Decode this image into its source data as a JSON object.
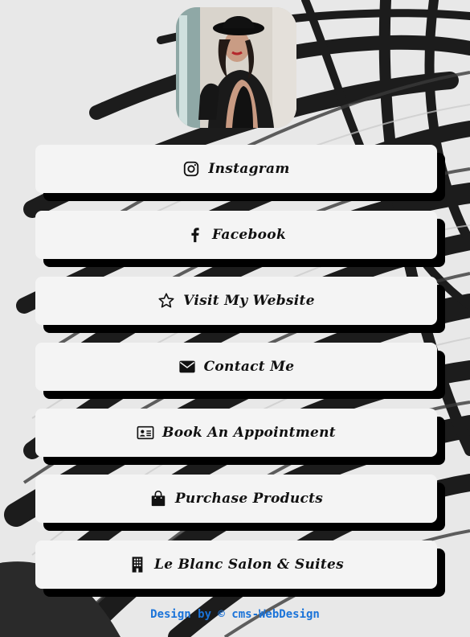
{
  "profile": {
    "avatar_alt": "avatar"
  },
  "links": [
    {
      "label": "Instagram",
      "icon": "instagram-icon"
    },
    {
      "label": "Facebook",
      "icon": "facebook-icon"
    },
    {
      "label": "Visit My Website",
      "icon": "star-icon"
    },
    {
      "label": "Contact Me",
      "icon": "envelope-icon"
    },
    {
      "label": "Book An Appointment",
      "icon": "id-card-icon"
    },
    {
      "label": "Purchase Products",
      "icon": "shopping-bag-icon"
    },
    {
      "label": "Le Blanc Salon & Suites",
      "icon": "building-icon"
    }
  ],
  "footer": {
    "credit": "Design by © cms-WebDesign"
  },
  "colors": {
    "button_bg": "#f4f4f4",
    "shadow": "#000000",
    "credit": "#1a73d9",
    "page_bg": "#e6e6e6"
  }
}
